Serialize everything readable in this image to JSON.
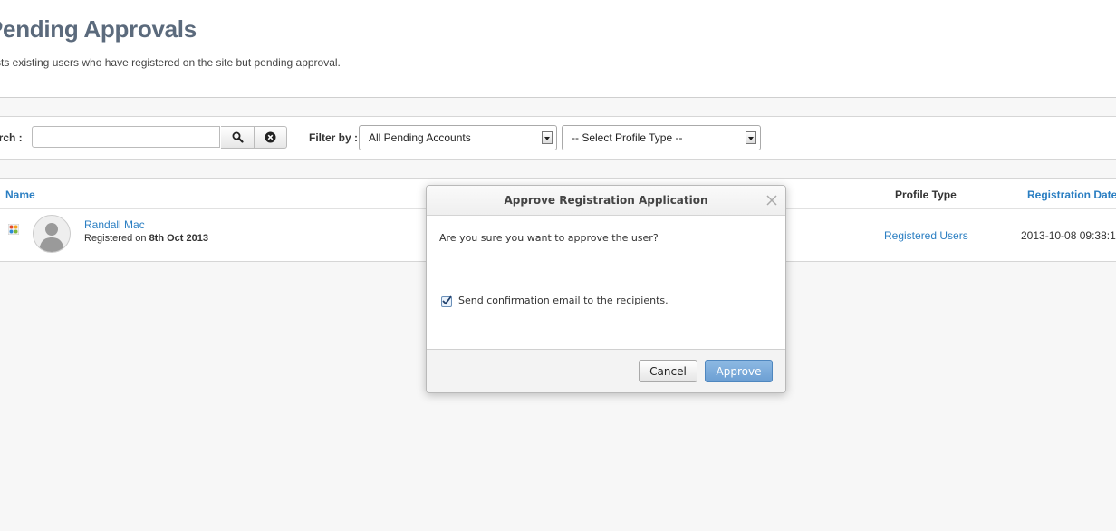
{
  "header": {
    "title": "Pending Approvals",
    "description": "sts existing users who have registered on the site but pending approval."
  },
  "toolbar": {
    "search_label": "arch :",
    "search_value": "",
    "search_icon": "search-icon",
    "clear_icon": "clear-icon",
    "filter_label": "Filter by :",
    "status_filter": "All Pending Accounts",
    "profile_filter": "-- Select Profile Type --"
  },
  "table": {
    "columns": {
      "name": "Name",
      "profile_type": "Profile Type",
      "registration_date": "Registration Date"
    },
    "rows": [
      {
        "name": "Randall Mac",
        "registered_prefix": "Registered on",
        "registered_date": "8th Oct 2013",
        "profile_type": "Registered Users",
        "registration_date": "2013-10-08 09:38:1"
      }
    ]
  },
  "modal": {
    "title": "Approve Registration Application",
    "message": "Are you sure you want to approve the user?",
    "checkbox_label": "Send confirmation email to the recipients.",
    "checkbox_checked": true,
    "cancel_label": "Cancel",
    "approve_label": "Approve"
  },
  "colors": {
    "link": "#2a7ec2",
    "title": "#5b6a7c",
    "approve_button": "#6c9fd3",
    "background": "#f7f7f7"
  }
}
